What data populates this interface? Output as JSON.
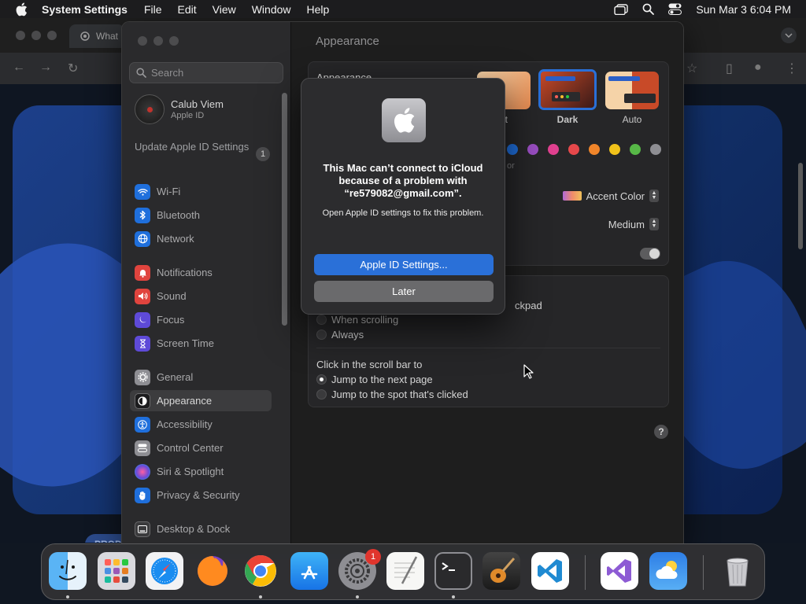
{
  "menubar": {
    "app_name": "System Settings",
    "menus": [
      "File",
      "Edit",
      "View",
      "Window",
      "Help"
    ],
    "clock": "Sun Mar 3  6:04 PM"
  },
  "browser": {
    "tab_title": "What",
    "banner_text": "PROD"
  },
  "settings": {
    "search_placeholder": "Search",
    "profile": {
      "name": "Calub Viem",
      "subtitle": "Apple ID"
    },
    "update": {
      "label": "Update Apple ID Settings",
      "count": "1"
    },
    "sidebar_items": [
      {
        "label": "Wi-Fi"
      },
      {
        "label": "Bluetooth"
      },
      {
        "label": "Network"
      },
      {
        "label": "Notifications"
      },
      {
        "label": "Sound"
      },
      {
        "label": "Focus"
      },
      {
        "label": "Screen Time"
      },
      {
        "label": "General"
      },
      {
        "label": "Appearance"
      },
      {
        "label": "Accessibility"
      },
      {
        "label": "Control Center"
      },
      {
        "label": "Siri & Spotlight"
      },
      {
        "label": "Privacy & Security"
      },
      {
        "label": "Desktop & Dock"
      }
    ],
    "page_title": "Appearance",
    "appearance_label": "Appearance",
    "modes": [
      {
        "label": "nt"
      },
      {
        "label": "Dark"
      },
      {
        "label": "Auto"
      }
    ],
    "selected_mode": "Dark",
    "accent_colors": [
      "#1f6fdc",
      "#9b4fc4",
      "#e0408f",
      "#e6484b",
      "#f0852a",
      "#f1c21a",
      "#57b847",
      "#8e8e93"
    ],
    "accent_color_label": "Accent Color",
    "highlight_hint": "or",
    "sidebar_icon_size": "Medium",
    "scroll_text_fragment": "ckpad",
    "show_scroll_bars_options": [
      "When scrolling",
      "Always"
    ],
    "click_scroll_label": "Click in the scroll bar to",
    "click_scroll_options": [
      "Jump to the next page",
      "Jump to the spot that's clicked"
    ],
    "help": "?"
  },
  "dialog": {
    "headline": "This Mac can’t connect to iCloud because of a problem with “re579082@gmail.com”.",
    "body": "Open Apple ID settings to fix this problem.",
    "primary_button": "Apple ID Settings...",
    "secondary_button": "Later"
  },
  "dock": {
    "apps": [
      "Finder",
      "Launchpad",
      "Safari",
      "Firefox",
      "Chrome",
      "App Store",
      "System Settings",
      "TextEdit",
      "Terminal",
      "GarageBand",
      "Visual Studio Code",
      "Visual Studio",
      "Weather",
      "Trash"
    ],
    "settings_badge": "1"
  }
}
